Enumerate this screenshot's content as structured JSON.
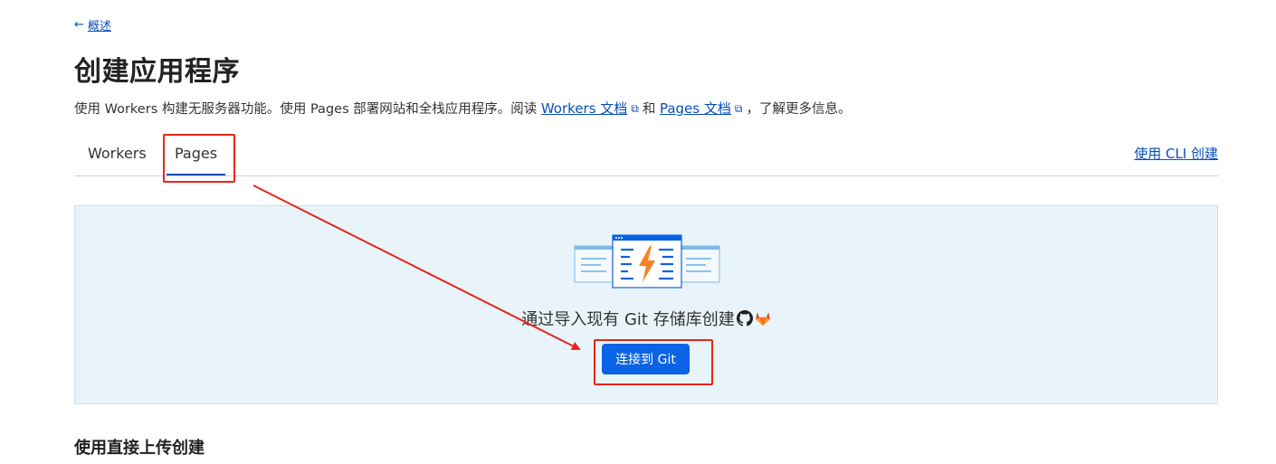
{
  "breadcrumb": {
    "arrow": "←",
    "label": "概述"
  },
  "page": {
    "title": "创建应用程序",
    "description": {
      "part1": "使用 Workers 构建无服务器功能。使用 Pages 部署网站和全栈应用程序。阅读 ",
      "workers_docs": "Workers 文档",
      "part2": "和 ",
      "pages_docs": "Pages 文档",
      "part3": "，了解更多信息。"
    }
  },
  "tabs": [
    {
      "label": "Workers",
      "active": false
    },
    {
      "label": "Pages",
      "active": true
    }
  ],
  "cli_link": "使用 CLI 创建",
  "git_panel": {
    "prompt": "通过导入现有 Git 存储库创建",
    "button": "连接到 Git",
    "icons": [
      "github-icon",
      "gitlab-icon"
    ]
  },
  "direct_upload": {
    "title": "使用直接上传创建"
  },
  "colors": {
    "accent": "#0b63e5",
    "link": "#0a4fb8",
    "panel_bg": "#e9f4fa",
    "annotation": "#e8251b"
  }
}
